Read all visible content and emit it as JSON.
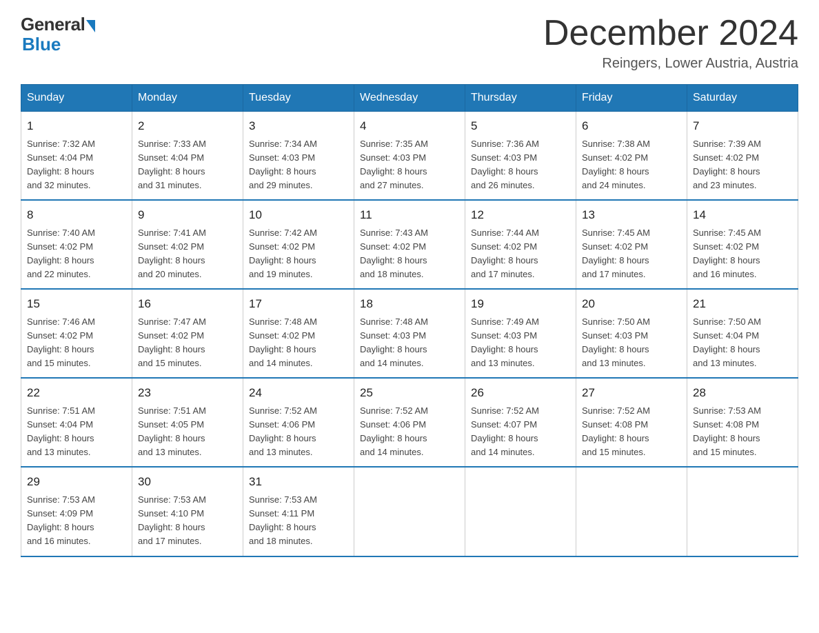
{
  "header": {
    "logo_general": "General",
    "logo_blue": "Blue",
    "month_title": "December 2024",
    "location": "Reingers, Lower Austria, Austria"
  },
  "weekdays": [
    "Sunday",
    "Monday",
    "Tuesday",
    "Wednesday",
    "Thursday",
    "Friday",
    "Saturday"
  ],
  "weeks": [
    [
      {
        "day": "1",
        "sunrise": "7:32 AM",
        "sunset": "4:04 PM",
        "daylight": "8 hours and 32 minutes."
      },
      {
        "day": "2",
        "sunrise": "7:33 AM",
        "sunset": "4:04 PM",
        "daylight": "8 hours and 31 minutes."
      },
      {
        "day": "3",
        "sunrise": "7:34 AM",
        "sunset": "4:03 PM",
        "daylight": "8 hours and 29 minutes."
      },
      {
        "day": "4",
        "sunrise": "7:35 AM",
        "sunset": "4:03 PM",
        "daylight": "8 hours and 27 minutes."
      },
      {
        "day": "5",
        "sunrise": "7:36 AM",
        "sunset": "4:03 PM",
        "daylight": "8 hours and 26 minutes."
      },
      {
        "day": "6",
        "sunrise": "7:38 AM",
        "sunset": "4:02 PM",
        "daylight": "8 hours and 24 minutes."
      },
      {
        "day": "7",
        "sunrise": "7:39 AM",
        "sunset": "4:02 PM",
        "daylight": "8 hours and 23 minutes."
      }
    ],
    [
      {
        "day": "8",
        "sunrise": "7:40 AM",
        "sunset": "4:02 PM",
        "daylight": "8 hours and 22 minutes."
      },
      {
        "day": "9",
        "sunrise": "7:41 AM",
        "sunset": "4:02 PM",
        "daylight": "8 hours and 20 minutes."
      },
      {
        "day": "10",
        "sunrise": "7:42 AM",
        "sunset": "4:02 PM",
        "daylight": "8 hours and 19 minutes."
      },
      {
        "day": "11",
        "sunrise": "7:43 AM",
        "sunset": "4:02 PM",
        "daylight": "8 hours and 18 minutes."
      },
      {
        "day": "12",
        "sunrise": "7:44 AM",
        "sunset": "4:02 PM",
        "daylight": "8 hours and 17 minutes."
      },
      {
        "day": "13",
        "sunrise": "7:45 AM",
        "sunset": "4:02 PM",
        "daylight": "8 hours and 17 minutes."
      },
      {
        "day": "14",
        "sunrise": "7:45 AM",
        "sunset": "4:02 PM",
        "daylight": "8 hours and 16 minutes."
      }
    ],
    [
      {
        "day": "15",
        "sunrise": "7:46 AM",
        "sunset": "4:02 PM",
        "daylight": "8 hours and 15 minutes."
      },
      {
        "day": "16",
        "sunrise": "7:47 AM",
        "sunset": "4:02 PM",
        "daylight": "8 hours and 15 minutes."
      },
      {
        "day": "17",
        "sunrise": "7:48 AM",
        "sunset": "4:02 PM",
        "daylight": "8 hours and 14 minutes."
      },
      {
        "day": "18",
        "sunrise": "7:48 AM",
        "sunset": "4:03 PM",
        "daylight": "8 hours and 14 minutes."
      },
      {
        "day": "19",
        "sunrise": "7:49 AM",
        "sunset": "4:03 PM",
        "daylight": "8 hours and 13 minutes."
      },
      {
        "day": "20",
        "sunrise": "7:50 AM",
        "sunset": "4:03 PM",
        "daylight": "8 hours and 13 minutes."
      },
      {
        "day": "21",
        "sunrise": "7:50 AM",
        "sunset": "4:04 PM",
        "daylight": "8 hours and 13 minutes."
      }
    ],
    [
      {
        "day": "22",
        "sunrise": "7:51 AM",
        "sunset": "4:04 PM",
        "daylight": "8 hours and 13 minutes."
      },
      {
        "day": "23",
        "sunrise": "7:51 AM",
        "sunset": "4:05 PM",
        "daylight": "8 hours and 13 minutes."
      },
      {
        "day": "24",
        "sunrise": "7:52 AM",
        "sunset": "4:06 PM",
        "daylight": "8 hours and 13 minutes."
      },
      {
        "day": "25",
        "sunrise": "7:52 AM",
        "sunset": "4:06 PM",
        "daylight": "8 hours and 14 minutes."
      },
      {
        "day": "26",
        "sunrise": "7:52 AM",
        "sunset": "4:07 PM",
        "daylight": "8 hours and 14 minutes."
      },
      {
        "day": "27",
        "sunrise": "7:52 AM",
        "sunset": "4:08 PM",
        "daylight": "8 hours and 15 minutes."
      },
      {
        "day": "28",
        "sunrise": "7:53 AM",
        "sunset": "4:08 PM",
        "daylight": "8 hours and 15 minutes."
      }
    ],
    [
      {
        "day": "29",
        "sunrise": "7:53 AM",
        "sunset": "4:09 PM",
        "daylight": "8 hours and 16 minutes."
      },
      {
        "day": "30",
        "sunrise": "7:53 AM",
        "sunset": "4:10 PM",
        "daylight": "8 hours and 17 minutes."
      },
      {
        "day": "31",
        "sunrise": "7:53 AM",
        "sunset": "4:11 PM",
        "daylight": "8 hours and 18 minutes."
      },
      null,
      null,
      null,
      null
    ]
  ],
  "labels": {
    "sunrise": "Sunrise:",
    "sunset": "Sunset:",
    "daylight": "Daylight:"
  }
}
